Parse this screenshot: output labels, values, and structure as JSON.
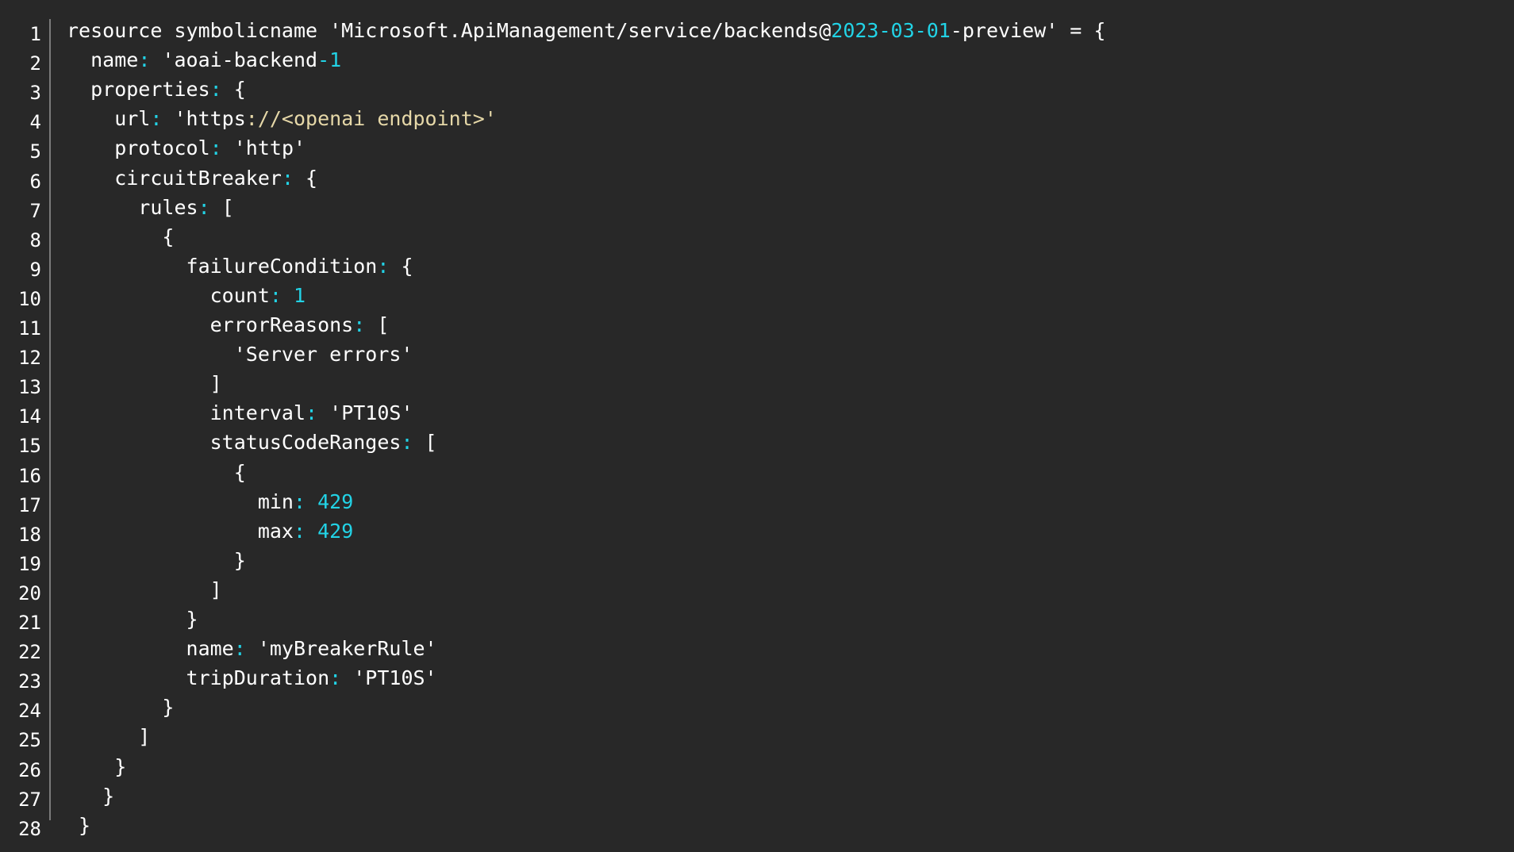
{
  "editor": {
    "language": "bicep",
    "colors": {
      "background": "#282828",
      "text": "#ffffff",
      "punctuation": "#22d3e6",
      "number": "#22d3e6",
      "url": "#e6d8a8",
      "gutter_border": "#7a7a7a"
    },
    "line_numbers": [
      "1",
      "2",
      "3",
      "4",
      "5",
      "6",
      "7",
      "8",
      "9",
      "10",
      "11",
      "12",
      "13",
      "14",
      "15",
      "16",
      "17",
      "18",
      "19",
      "20",
      "21",
      "22",
      "23",
      "24",
      "25",
      "26",
      "27",
      "28"
    ],
    "lines": [
      [
        {
          "t": "resource symbolicname 'Microsoft.ApiManagement/service/backends@",
          "c": "plain"
        },
        {
          "t": "2023-03-01",
          "c": "num"
        },
        {
          "t": "-preview' = {",
          "c": "plain"
        }
      ],
      [
        {
          "t": "  name",
          "c": "plain"
        },
        {
          "t": ":",
          "c": "punct"
        },
        {
          "t": " 'aoai-backend",
          "c": "plain"
        },
        {
          "t": "-1",
          "c": "num"
        }
      ],
      [
        {
          "t": "  properties",
          "c": "plain"
        },
        {
          "t": ":",
          "c": "punct"
        },
        {
          "t": " {",
          "c": "plain"
        }
      ],
      [
        {
          "t": "    url",
          "c": "plain"
        },
        {
          "t": ":",
          "c": "punct"
        },
        {
          "t": " 'https",
          "c": "plain"
        },
        {
          "t": "://<openai endpoint>'",
          "c": "url"
        }
      ],
      [
        {
          "t": "    protocol",
          "c": "plain"
        },
        {
          "t": ":",
          "c": "punct"
        },
        {
          "t": " 'http'",
          "c": "plain"
        }
      ],
      [
        {
          "t": "    circuitBreaker",
          "c": "plain"
        },
        {
          "t": ":",
          "c": "punct"
        },
        {
          "t": " {",
          "c": "plain"
        }
      ],
      [
        {
          "t": "      rules",
          "c": "plain"
        },
        {
          "t": ":",
          "c": "punct"
        },
        {
          "t": " [",
          "c": "plain"
        }
      ],
      [
        {
          "t": "        {",
          "c": "plain"
        }
      ],
      [
        {
          "t": "          failureCondition",
          "c": "plain"
        },
        {
          "t": ":",
          "c": "punct"
        },
        {
          "t": " {",
          "c": "plain"
        }
      ],
      [
        {
          "t": "            count",
          "c": "plain"
        },
        {
          "t": ":",
          "c": "punct"
        },
        {
          "t": " ",
          "c": "plain"
        },
        {
          "t": "1",
          "c": "num"
        }
      ],
      [
        {
          "t": "            errorReasons",
          "c": "plain"
        },
        {
          "t": ":",
          "c": "punct"
        },
        {
          "t": " [",
          "c": "plain"
        }
      ],
      [
        {
          "t": "              'Server errors'",
          "c": "plain"
        }
      ],
      [
        {
          "t": "            ]",
          "c": "plain"
        }
      ],
      [
        {
          "t": "            interval",
          "c": "plain"
        },
        {
          "t": ":",
          "c": "punct"
        },
        {
          "t": " 'PT10S'",
          "c": "plain"
        }
      ],
      [
        {
          "t": "            statusCodeRanges",
          "c": "plain"
        },
        {
          "t": ":",
          "c": "punct"
        },
        {
          "t": " [",
          "c": "plain"
        }
      ],
      [
        {
          "t": "              {",
          "c": "plain"
        }
      ],
      [
        {
          "t": "                min",
          "c": "plain"
        },
        {
          "t": ":",
          "c": "punct"
        },
        {
          "t": " ",
          "c": "plain"
        },
        {
          "t": "429",
          "c": "num"
        }
      ],
      [
        {
          "t": "                max",
          "c": "plain"
        },
        {
          "t": ":",
          "c": "punct"
        },
        {
          "t": " ",
          "c": "plain"
        },
        {
          "t": "429",
          "c": "num"
        }
      ],
      [
        {
          "t": "              }",
          "c": "plain"
        }
      ],
      [
        {
          "t": "            ]",
          "c": "plain"
        }
      ],
      [
        {
          "t": "          }",
          "c": "plain"
        }
      ],
      [
        {
          "t": "          name",
          "c": "plain"
        },
        {
          "t": ":",
          "c": "punct"
        },
        {
          "t": " 'myBreakerRule'",
          "c": "plain"
        }
      ],
      [
        {
          "t": "          tripDuration",
          "c": "plain"
        },
        {
          "t": ":",
          "c": "punct"
        },
        {
          "t": " 'PT10S'",
          "c": "plain"
        }
      ],
      [
        {
          "t": "        }",
          "c": "plain"
        }
      ],
      [
        {
          "t": "      ]",
          "c": "plain"
        }
      ],
      [
        {
          "t": "    }",
          "c": "plain"
        }
      ],
      [
        {
          "t": "   }",
          "c": "plain"
        }
      ],
      [
        {
          "t": " }",
          "c": "plain"
        }
      ]
    ]
  }
}
